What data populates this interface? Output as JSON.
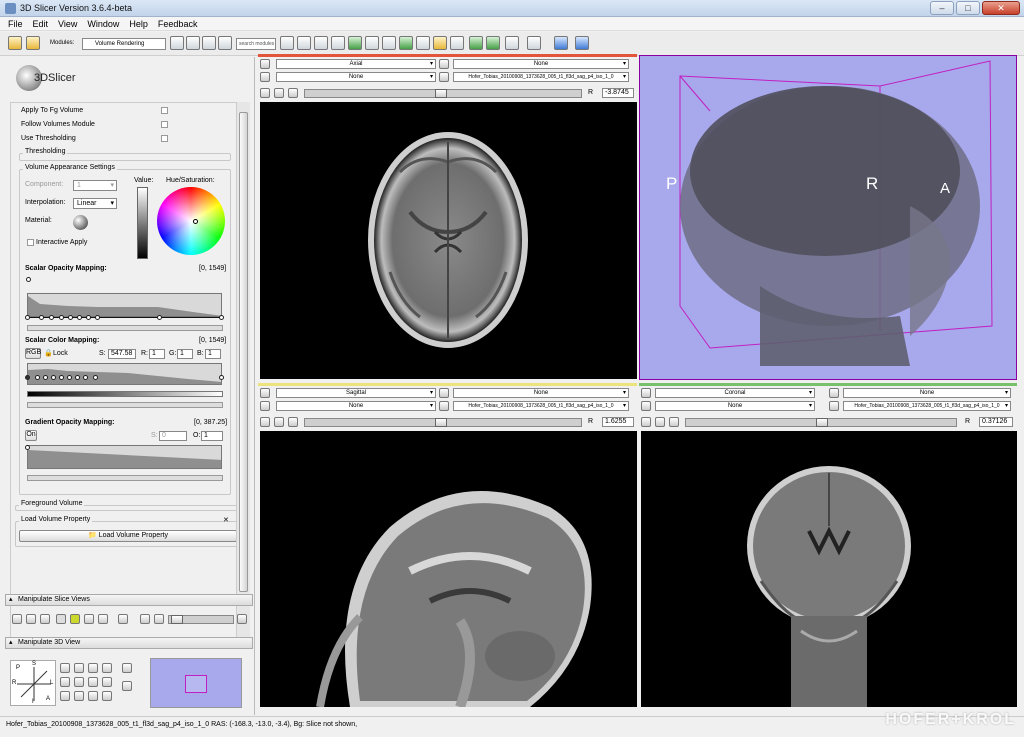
{
  "window": {
    "title": "3D Slicer Version 3.6.4-beta",
    "buttons": [
      "–",
      "□",
      "✕"
    ]
  },
  "menu": [
    "File",
    "Edit",
    "View",
    "Window",
    "Help",
    "Feedback"
  ],
  "toolbar": {
    "modules_label": "Modules:",
    "module_value": "Volume Rendering",
    "search_placeholder": "search modules"
  },
  "logo": {
    "text": "3DSlicer"
  },
  "panel": {
    "checks": [
      "Apply To Fg Volume",
      "Follow Volumes Module",
      "Use Thresholding"
    ],
    "thresholding_label": "Thresholding",
    "appearance_title": "Volume Appearance Settings",
    "component_label": "Component:",
    "component_value": "1",
    "interpolation_label": "Interpolation:",
    "interpolation_value": "Linear",
    "material_label": "Material:",
    "value_label": "Value:",
    "hue_label": "Hue/Saturation:",
    "interactive_apply": "Interactive Apply",
    "scalar_opacity_title": "Scalar Opacity Mapping:",
    "scalar_opacity_range": "[0, 1549]",
    "scalar_color_title": "Scalar Color Mapping:",
    "scalar_color_range": "[0, 1549]",
    "rgb_btn": "RGB",
    "lock_label": "Lock",
    "s_label": "S:",
    "s_value": "547.58",
    "r_label": "R:",
    "r_value": "1",
    "g_label": "G:",
    "g_value": "1",
    "b_label": "B:",
    "b_value": "1",
    "gradient_title": "Gradient Opacity Mapping:",
    "gradient_range": "[0, 387.25]",
    "on_btn": "On",
    "gs_label": "S:",
    "gs_value": "0",
    "go_label": "O:",
    "go_value": "1",
    "foreground_volume": "Foreground Volume",
    "load_volume_property": "Load Volume Property",
    "load_btn": "Load Volume Property",
    "manipulate_slice": "Manipulate Slice Views",
    "manipulate_3d": "Manipulate 3D View"
  },
  "views": {
    "axial": {
      "orientation": "Axial",
      "fg": "None",
      "lb": "None",
      "bg": "Hofer_Tobias_20100908_1373628_005_t1_fl3d_sag_p4_iso_1_0",
      "r_label": "R",
      "offset": "-3.8745",
      "color": "#e2553a"
    },
    "sagittal": {
      "orientation": "Sagittal",
      "fg": "None",
      "lb": "None",
      "bg": "Hofer_Tobias_20100908_1373628_005_t1_fl3d_sag_p4_iso_1_0",
      "r_label": "R",
      "offset": "1.6255",
      "color": "#ece37c"
    },
    "coronal": {
      "orientation": "Coronal",
      "fg": "None",
      "lb": "None",
      "bg": "Hofer_Tobias_20100908_1373628_005_t1_fl3d_sag_p4_iso_1_0",
      "r_label": "R",
      "offset": "0.37126",
      "color": "#78c06a"
    },
    "view3d": {
      "label_p": "P",
      "label_r": "R",
      "label_a": "A",
      "bg_color": "#a8a8ec",
      "box_color": "#c020c0"
    }
  },
  "orientation_labels": {
    "p": "P",
    "s": "S",
    "r": "R",
    "l": "L",
    "a": "A",
    "i": "I"
  },
  "status": {
    "text": "Hofer_Tobias_20100908_1373628_005_t1_fl3d_sag_p4_iso_1_0 RAS: (-168.3, -13.0, -3.4), Bg: Slice not shown,"
  },
  "watermark": "HOFER+KROL"
}
